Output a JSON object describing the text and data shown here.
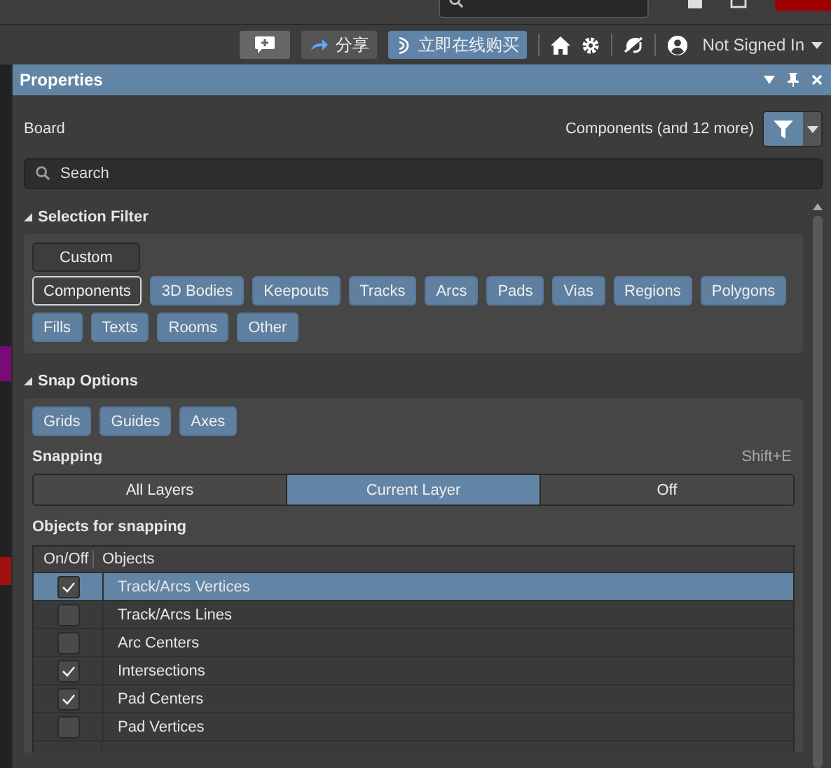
{
  "toolbar": {
    "share": "分享",
    "buy": "立即在线购买",
    "user": "Not Signed In"
  },
  "panel": {
    "title": "Properties",
    "context": "Board",
    "filter_summary": "Components (and 12 more)",
    "search": {
      "placeholder": "Search"
    }
  },
  "selection_filter": {
    "title": "Selection Filter",
    "expanded": true,
    "custom": "Custom",
    "items": [
      {
        "label": "Components",
        "selected": true
      },
      {
        "label": "3D Bodies",
        "selected": false
      },
      {
        "label": "Keepouts",
        "selected": false
      },
      {
        "label": "Tracks",
        "selected": false
      },
      {
        "label": "Arcs",
        "selected": false
      },
      {
        "label": "Pads",
        "selected": false
      },
      {
        "label": "Vias",
        "selected": false
      },
      {
        "label": "Regions",
        "selected": false
      },
      {
        "label": "Polygons",
        "selected": false
      },
      {
        "label": "Fills",
        "selected": false
      },
      {
        "label": "Texts",
        "selected": false
      },
      {
        "label": "Rooms",
        "selected": false
      },
      {
        "label": "Other",
        "selected": false
      }
    ]
  },
  "snap_options": {
    "title": "Snap Options",
    "expanded": true,
    "guides": [
      {
        "label": "Grids",
        "on": true
      },
      {
        "label": "Guides",
        "on": true
      },
      {
        "label": "Axes",
        "on": true
      }
    ],
    "snapping_label": "Snapping",
    "shortcut": "Shift+E",
    "snapping": [
      {
        "label": "All Layers",
        "selected": false
      },
      {
        "label": "Current Layer",
        "selected": true
      },
      {
        "label": "Off",
        "selected": false
      }
    ],
    "objects_label": "Objects for snapping",
    "columns": [
      "On/Off",
      "Objects"
    ],
    "rows": [
      {
        "name": "Track/Arcs Vertices",
        "checked": true,
        "selected": true
      },
      {
        "name": "Track/Arcs Lines",
        "checked": false,
        "selected": false
      },
      {
        "name": "Arc Centers",
        "checked": false,
        "selected": false
      },
      {
        "name": "Intersections",
        "checked": true,
        "selected": false
      },
      {
        "name": "Pad Centers",
        "checked": true,
        "selected": false
      },
      {
        "name": "Pad Vertices",
        "checked": false,
        "selected": false
      }
    ]
  }
}
